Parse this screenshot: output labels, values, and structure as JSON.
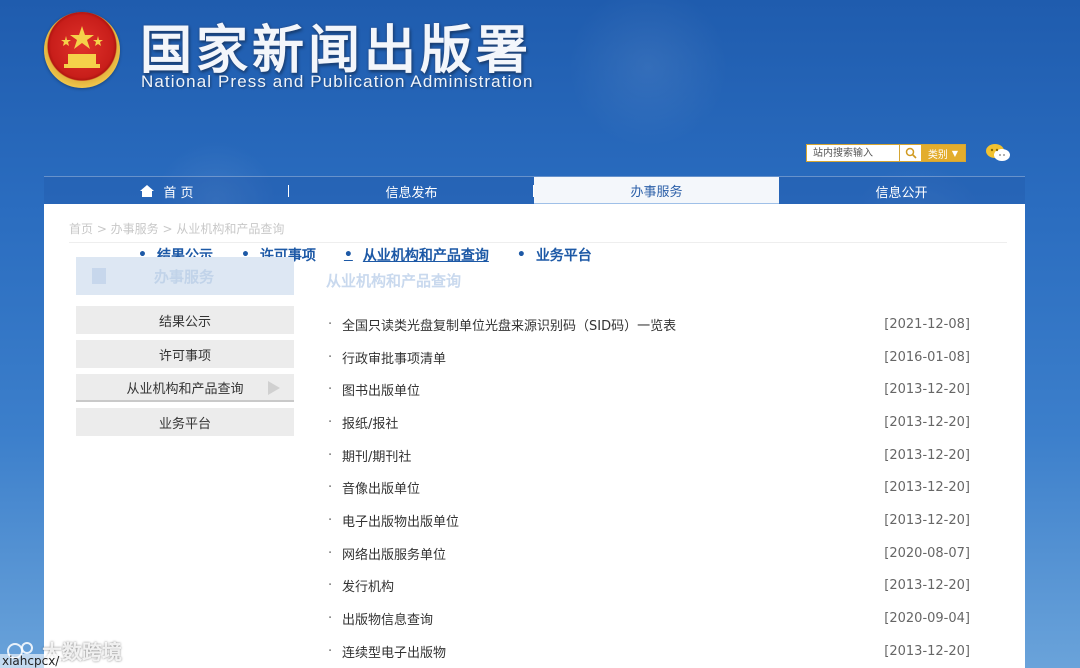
{
  "header": {
    "title": "国家新闻出版署",
    "subtitle": "National  Press and Publication Administration"
  },
  "search": {
    "placeholder": "站内搜索输入",
    "category_label": "类别"
  },
  "nav": {
    "items": [
      {
        "label": "首 页",
        "icon": "home-icon"
      },
      {
        "label": "信息发布"
      },
      {
        "label": "办事服务",
        "active": true
      },
      {
        "label": "信息公开"
      }
    ]
  },
  "breadcrumb": "首页 > 办事服务 > 从业机构和产品查询",
  "tabs": [
    "结果公示",
    "许可事项",
    "从业机构和产品查询",
    "业务平台"
  ],
  "sidebar": {
    "heading": "办事服务",
    "items": [
      "结果公示",
      "许可事项",
      "从业机构和产品查询",
      "业务平台"
    ]
  },
  "main": {
    "section_title": "从业机构和产品查询",
    "rows": [
      {
        "title": "全国只读类光盘复制单位光盘来源识别码（SID码）一览表",
        "date": "[2021-12-08]"
      },
      {
        "title": "行政审批事项清单",
        "date": "[2016-01-08]"
      },
      {
        "title": "图书出版单位",
        "date": "[2013-12-20]"
      },
      {
        "title": "报纸/报社",
        "date": "[2013-12-20]"
      },
      {
        "title": "期刊/期刊社",
        "date": "[2013-12-20]"
      },
      {
        "title": "音像出版单位",
        "date": "[2013-12-20]"
      },
      {
        "title": "电子出版物出版单位",
        "date": "[2013-12-20]"
      },
      {
        "title": "网络出版服务单位",
        "date": "[2020-08-07]"
      },
      {
        "title": "发行机构",
        "date": "[2013-12-20]"
      },
      {
        "title": "出版物信息查询",
        "date": "[2020-09-04]"
      },
      {
        "title": "连续型电子出版物",
        "date": "[2013-12-20]"
      }
    ]
  },
  "watermark": {
    "text": "大数跨境",
    "url": "xiahcpcx/"
  },
  "colors": {
    "accent_blue": "#1d59a6",
    "brand_gold": "#e3ad2d"
  }
}
